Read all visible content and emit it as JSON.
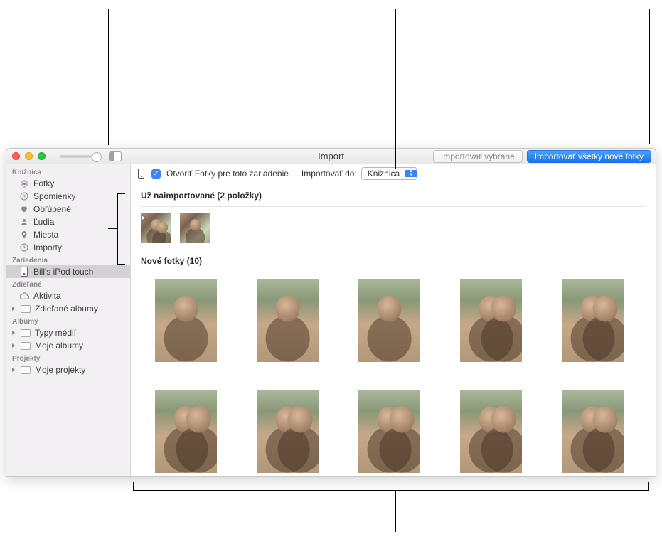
{
  "window_title": "Import",
  "toolbar": {
    "import_selected": "Importovať vybrané",
    "import_all_new": "Importovať všetky nové fotky"
  },
  "import_bar": {
    "open_photos_for_device": "Otvoriť Fotky pre toto zariadenie",
    "import_to_label": "Importovať do:",
    "import_to_value": "Knižnica"
  },
  "sidebar": {
    "library_header": "Knižnica",
    "library_items": [
      {
        "label": "Fotky",
        "icon": "photos"
      },
      {
        "label": "Spomienky",
        "icon": "clock"
      },
      {
        "label": "Obľúbené",
        "icon": "heart"
      },
      {
        "label": "Ľudia",
        "icon": "person"
      },
      {
        "label": "Miesta",
        "icon": "pin"
      },
      {
        "label": "Importy",
        "icon": "clock"
      }
    ],
    "devices_header": "Zariadenia",
    "device_item": "Bill's iPod touch",
    "shared_header": "Zdieľané",
    "shared_items": [
      {
        "label": "Aktivita",
        "icon": "cloud"
      },
      {
        "label": "Zdieľané albumy",
        "icon": "album",
        "disclosure": true
      }
    ],
    "albums_header": "Albumy",
    "albums_items": [
      {
        "label": "Typy médií",
        "icon": "album",
        "disclosure": true
      },
      {
        "label": "Moje albumy",
        "icon": "album",
        "disclosure": true
      }
    ],
    "projects_header": "Projekty",
    "projects_items": [
      {
        "label": "Moje projekty",
        "icon": "album",
        "disclosure": true
      }
    ]
  },
  "sections": {
    "already_imported": "Už naimportované (2 položky)",
    "new_photos": "Nové fotky (10)"
  },
  "counts": {
    "already_imported": 2,
    "new_photos": 10
  }
}
